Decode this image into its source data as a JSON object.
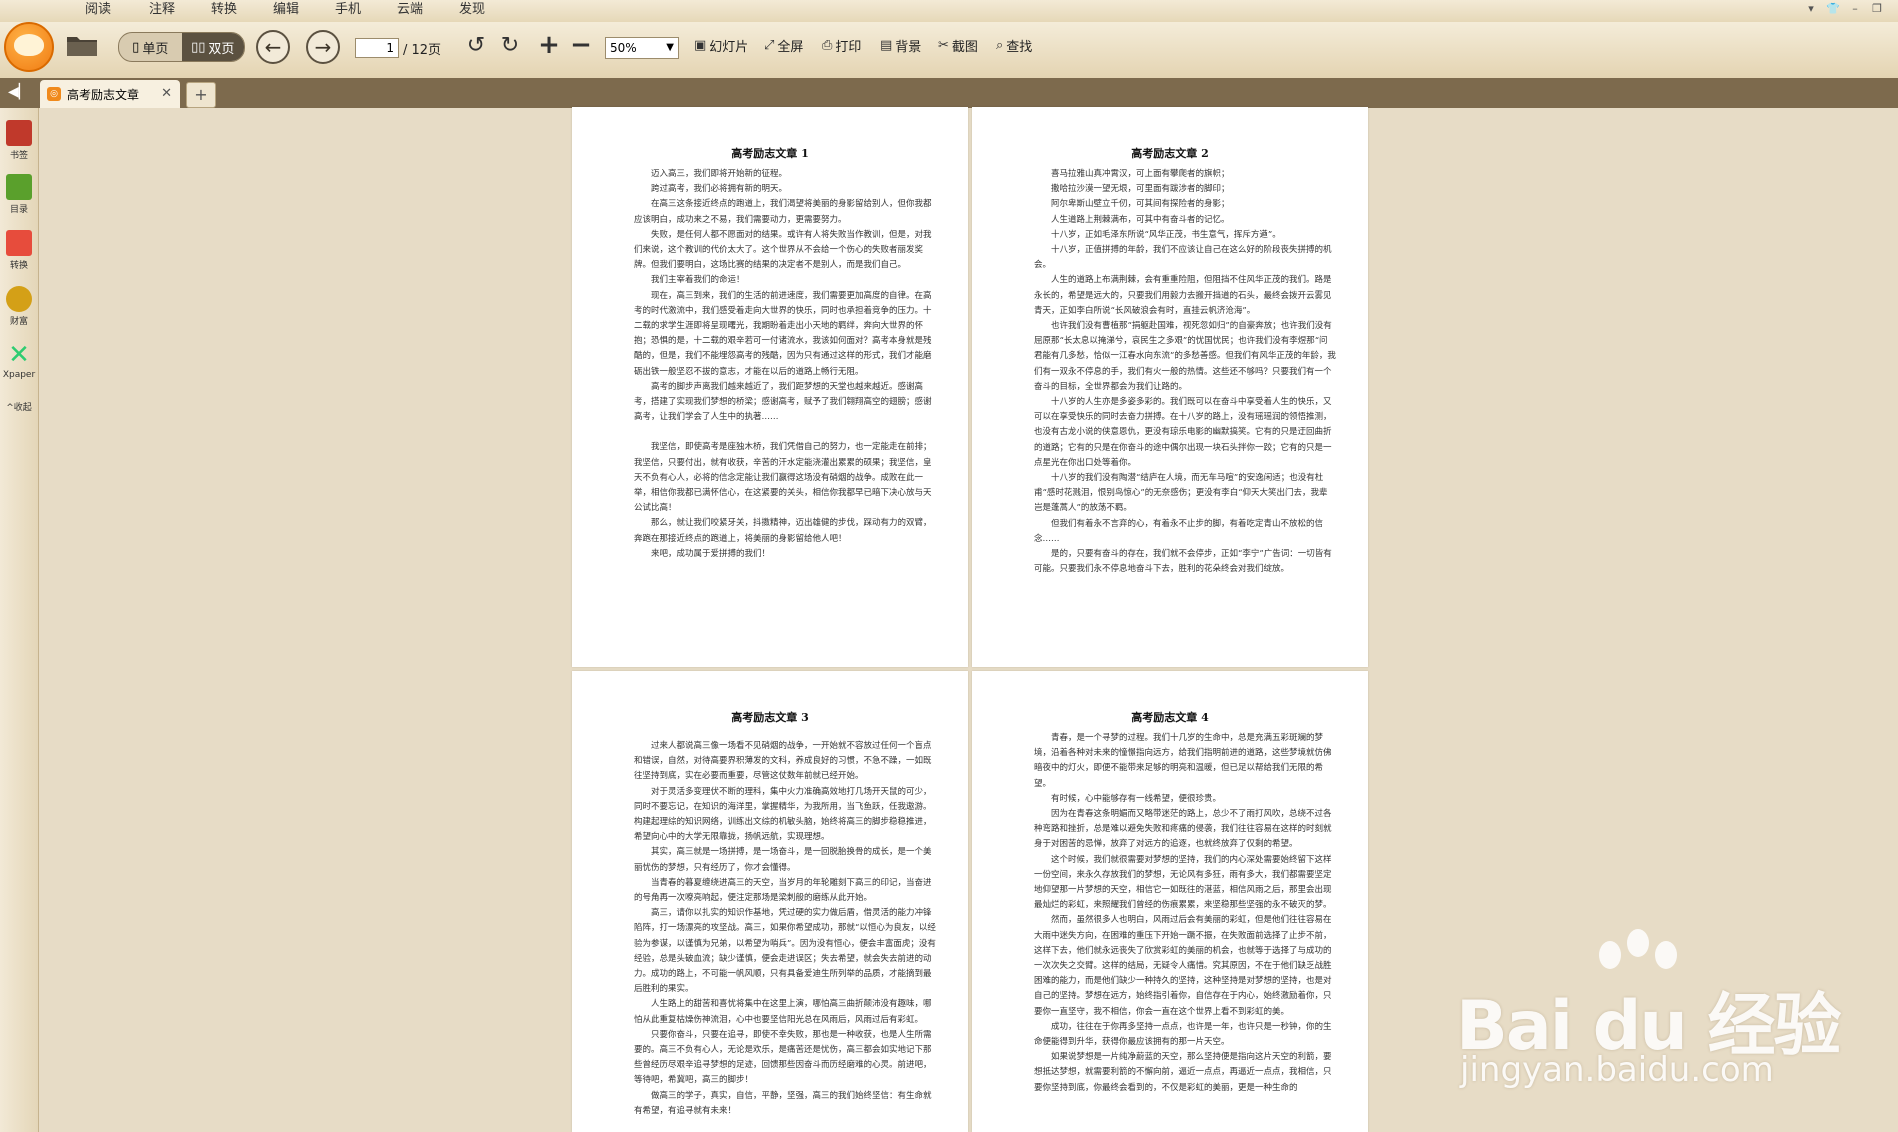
{
  "menu": [
    "阅读",
    "注释",
    "转换",
    "编辑",
    "手机",
    "云端",
    "发现"
  ],
  "toolbar": {
    "single_label": "单页",
    "double_label": "双页",
    "page_current": "1",
    "page_total": "/ 12页",
    "zoom": "50%",
    "slideshow": "幻灯片",
    "fullscreen": "全屏",
    "print": "打印",
    "background": "背景",
    "screenshot": "截图",
    "find": "查找"
  },
  "tab": {
    "title": "高考励志文章",
    "add": "+"
  },
  "sidebar": [
    {
      "label": "书签",
      "icon": "bookmark-icon",
      "color": "#c0392b"
    },
    {
      "label": "目录",
      "icon": "toc-icon",
      "color": "#5aa02c"
    },
    {
      "label": "转换",
      "icon": "convert-icon",
      "color": "#e74c3c"
    },
    {
      "label": "财富",
      "icon": "wealth-icon",
      "color": "#d4a017"
    },
    {
      "label": "Xpaper",
      "icon": "xpaper-icon",
      "color": "#2ecc71"
    },
    {
      "label": "收起",
      "icon": "collapse-icon",
      "color": "#555555"
    }
  ],
  "pages": [
    {
      "title": "高考励志文章 1",
      "paragraphs": [
        "迈入高三，我们即将开始新的征程。",
        "跨过高考，我们必将拥有新的明天。",
        "在高三这条接近终点的跑道上，我们渴望将美丽的身影留给别人，但你我都应该明白，成功来之不易，我们需要动力，更需要努力。",
        "失败，是任何人都不愿面对的结果。或许有人将失败当作教训，但是，对我们来说，这个教训的代价太大了。这个世界从不会给一个伤心的失败者丽发奖牌。但我们要明白，这场比赛的结果的决定者不是别人，而是我们自己。",
        "我们主宰着我们的命运！",
        "现在，高三到来，我们的生活的前进速度，我们需要更加高度的自律。在高考的时代激流中，我们感受着走向大世界的快乐，同时也承担着竞争的压力。十二载的求学生涯即将呈现曙光，我期盼着走出小天地的羁绊，奔向大世界的怀抱；恐惧的是，十二载的艰辛若可一付诸流水，我该如何面对？高考本身就是残酷的，但是，我们不能埋怨高考的残酷，因为只有通过这样的形式，我们才能磨砺出铁一般坚忍不拔的意志，才能在以后的道路上畅行无阻。",
        "高考的脚步声离我们越来越近了，我们距梦想的天堂也越来越近。感谢高考，搭建了实现我们梦想的桥梁；感谢高考，赋予了我们翱翔高空的翅膀；感谢高考，让我们学会了人生中的执著……",
        "",
        "我坚信，即使高考是座独木桥，我们凭借自己的努力，也一定能走在前排；我坚信，只要付出，就有收获，辛苦的汗水定能浇灌出累累的硕果；我坚信，皇天不负有心人，必将的信念定能让我们赢得这场没有硝烟的战争。成败在此一举，相信你我都已满怀信心，在这紧要的关头，相信你我都早已暗下决心放与天公试比高！",
        "那么，就让我们咬紧牙关，抖擞精神，迈出雄健的步伐，踩动有力的双臂，奔跑在那接近终点的跑道上，将美丽的身影留给他人吧！",
        "来吧，成功属于爱拼搏的我们！"
      ]
    },
    {
      "title": "高考励志文章 2",
      "paragraphs": [
        "喜马拉雅山真冲霄汉，可上面有攀爬者的旗帜；",
        "撒哈拉沙漠一望无垠，可里面有跋涉者的脚印；",
        "阿尔卑斯山壁立千仞，可其间有探险者的身影；",
        "人生道路上荆棘满布，可其中有奋斗者的记忆。",
        "十八岁，正如毛泽东所说“风华正茂，书生意气，挥斥方遒”。",
        "十八岁，正值拼搏的年龄，我们不应该让自己在这么好的阶段丧失拼搏的机会。",
        "人生的道路上布满荆棘，会有重重险阻，但阻挡不住风华正茂的我们。路是永长的，希望是远大的，只要我们用毅力去搬开挡道的石头，最终会拨开云雾见青天，正如李白所说“长风破浪会有时，直挂云帆济沧海”。",
        "也许我们没有曹植那“捐躯赴国难，视死忽如归”的自豪奔放；也许我们没有屈原那“长太息以掩涕兮，哀民生之多艰”的忧国忧民；也许我们没有李煜那“问君能有几多愁，恰似一江春水向东流”的多愁善感。但我们有风华正茂的年龄，我们有一双永不停息的手，我们有火一般的热情。这些还不够吗？只要我们有一个奋斗的目标，全世界都会为我们让路的。",
        "十八岁的人生亦是多姿多彩的。我们既可以在奋斗中享受着人生的快乐，又可以在享受快乐的同时去奋力拼搏。在十八岁的路上，没有瑶瑶润的领悟推测，也没有古龙小说的侠意恩仇，更没有琼乐电影的幽默搞笑。它有的只是迂回曲折的道路；它有的只是在你奋斗的途中偶尔出现一块石头拌你一跤；它有的只是一点星光在你出口处等着你。",
        "十八岁的我们没有陶潜“结庐在人境，而无车马喧”的安逸闲适；也没有杜甫“感时花溅泪，恨别鸟惊心”的无奈感伤；更没有李白“仰天大笑出门去，我辈岂是蓬蒿人”的放荡不羁。",
        "但我们有着永不言弃的心，有着永不止步的脚，有着吃定青山不放松的信念……",
        "是的，只要有奋斗的存在，我们就不会停步，正如“李宁”广告词：一切皆有可能。只要我们永不停息地奋斗下去，胜利的花朵终会对我们绽放。"
      ]
    },
    {
      "title": "高考励志文章 3",
      "paragraphs": [
        "",
        "过来人都说高三像一场看不见硝烟的战争，一开始就不容放过任何一个盲点和错误，自然，对待高要界积薄发的文科，养成良好的习惯，不急不躁，一如既往坚持到底，实在必要而重要，尽管这仗数年前就已经开始。",
        "对于灵活多变理伏不断的理科，集中火力准确高效地打几场开天鼠的可少，同时不要忘记，在知识的海洋里，掌握精华，为我所用，当飞鱼跃，任我遨游。构建起理综的知识网络，训练出文综的机敏头脑，始终将高三的脚步稳稳推进，希望向心中的大学无限靠拢，扬帆远航，实现理想。",
        "其实，高三就是一场拼搏，是一场奋斗，是一回脱胎换骨的成长，是一个美丽忧伤的梦想，只有经历了，你才会懂得。",
        "当青春的暮夏缠绕进高三的天空，当岁月的年轮雕刻下高三的印记，当奋进的号角再一次嘹亮响起，便注定那场是梁刺般的磨练从此开始。",
        "高三，请你以扎实的知识作基地，凭过硬的实力做后盾，借灵活的能力冲锋陷阵，打一场漂亮的攻坚战。高三，如果你希望成功，那就“以恒心为良友，以经验为参谋，以谨慎为兄弟，以希望为哨兵”。因为没有恒心，便会丰富面虎；没有经验，总是头破血流；缺少谨慎，便会走进误区；失去希望，就会失去前进的动力。成功的路上，不可能一帆风顺，只有具备爱迪生所列举的品质，才能摘到最后胜利的果实。",
        "人生路上的甜苦和喜忧将集中在这里上演，哪怕高三曲折颠沛没有趣味，哪怕从此重复枯燥伤神流泪，心中也要坚信阳光总在风雨后，风雨过后有彩虹。",
        "只要你奋斗，只要在追寻，即使不幸失败，那也是一种收获，也是人生所需要的。高三不负有心人，无论是欢乐，是痛苦还是忧伤，高三都会如实地记下那些曾经历尽艰辛追寻梦想的足迹，回馈那些因奋斗而历经磨难的心灵。前进吧，等待吧，希冀吧，高三的脚步！",
        "做高三的学子，真实，自信，平静，坚强，高三的我们始终坚信：有生命就有希望，有追寻就有未来！"
      ]
    },
    {
      "title": "高考励志文章 4",
      "paragraphs": [
        "青春，是一个寻梦的过程。我们十几岁的生命中，总是充满五彩斑斓的梦境，沿着各种对未来的憧憬指向远方，给我们指明前进的道路，这些梦境就仿佛暗夜中的灯火，即便不能带来足够的明亮和温暖，但已足以帮给我们无限的希望。",
        "有时候，心中能够存有一线希望，便很珍贵。",
        "因为在青春这条明媚而又略带迷茫的路上，总少不了雨打风吹，总绕不过各种弯路和挫折，总是难以避免失败和疼痛的侵袭，我们往往容易在这样的时刻就身于对困苦的忌惮，放弃了对远方的追逐，也就终放弃了仅剩的希望。",
        "这个时候，我们就很需要对梦想的坚持，我们的内心深处需要始终留下这样一份空间，来永久存放我们的梦想，无论风有多狂，雨有多大，我们都需要坚定地仰望那一片梦想的天空，相信它一如既往的湛蓝，相信风雨之后，那里会出现最灿烂的彩虹，来照耀我们曾经的伤痕累累，来坚稳那些坚强的永不破灭的梦。",
        "然而，虽然很多人也明白，风雨过后会有美丽的彩虹，但是他们往往容易在大雨中迷失方向，在困难的重压下开始一蹶不振，在失败面前选择了止步不前，这样下去，他们就永远丧失了欣赏彩虹的美丽的机会，也就等于选择了与成功的一次次失之交臂。这样的结局，无疑令人痛惜。究其原因，不在于他们缺乏战胜困难的能力，而是他们缺少一种持久的坚持，这种坚持是对梦想的坚持，也是对自己的坚持。梦想在远方，始终指引着你，自信存在于内心，始终激励着你，只要你一直坚守，我不相信，你会一直在这个世界上看不到彩虹的美。",
        "成功，往往在于你再多坚持一点点，也许是一年，也许只是一秒钟，你的生命便能得到升华，获得你最应该拥有的那一片天空。",
        "如果说梦想是一片纯净蔚蓝的天空，那么坚持便是指向这片天空的利箭，要想抵达梦想，就需要利箭的不懈向前，逼近一点点，再逼近一点点，我相信，只要你坚持到底，你最终会看到的，不仅是彩虹的美丽，更是一种生命的"
      ]
    }
  ],
  "watermark": {
    "brand": "Bai du 经验",
    "url": "jingyan.baidu.com"
  }
}
